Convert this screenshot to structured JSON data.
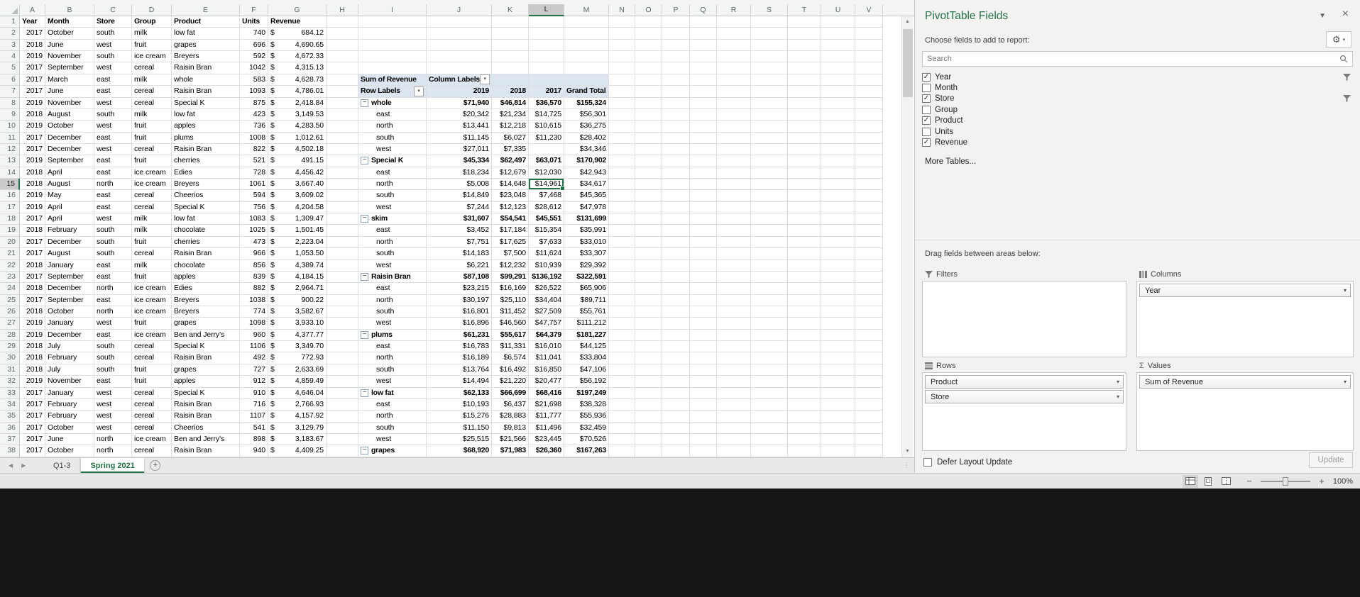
{
  "sheet": {
    "column_letters": [
      "A",
      "B",
      "C",
      "D",
      "E",
      "F",
      "G",
      "H",
      "I",
      "J",
      "K",
      "L",
      "M",
      "N",
      "O",
      "P",
      "Q",
      "R",
      "S",
      "T",
      "U",
      "V"
    ],
    "selected": {
      "col": "L",
      "row": 15
    },
    "table": {
      "headers": [
        "Year",
        "Month",
        "Store",
        "Group",
        "Product",
        "Units",
        "Revenue"
      ],
      "rows": [
        [
          2017,
          "October",
          "south",
          "milk",
          "low fat",
          740,
          684.12
        ],
        [
          2018,
          "June",
          "west",
          "fruit",
          "grapes",
          696,
          4690.65
        ],
        [
          2019,
          "November",
          "south",
          "ice cream",
          "Breyers",
          592,
          4672.33
        ],
        [
          2017,
          "September",
          "west",
          "cereal",
          "Raisin Bran",
          1042,
          4315.13
        ],
        [
          2017,
          "March",
          "east",
          "milk",
          "whole",
          583,
          4628.73
        ],
        [
          2017,
          "June",
          "east",
          "cereal",
          "Raisin Bran",
          1093,
          4786.01
        ],
        [
          2019,
          "November",
          "west",
          "cereal",
          "Special K",
          875,
          2418.84
        ],
        [
          2018,
          "August",
          "south",
          "milk",
          "low fat",
          423,
          3149.53
        ],
        [
          2019,
          "October",
          "west",
          "fruit",
          "apples",
          736,
          4283.5
        ],
        [
          2017,
          "December",
          "east",
          "fruit",
          "plums",
          1008,
          1012.61
        ],
        [
          2017,
          "December",
          "west",
          "cereal",
          "Raisin Bran",
          822,
          4502.18
        ],
        [
          2019,
          "September",
          "east",
          "fruit",
          "cherries",
          521,
          491.15
        ],
        [
          2018,
          "April",
          "east",
          "ice cream",
          "Edies",
          728,
          4456.42
        ],
        [
          2018,
          "August",
          "north",
          "ice cream",
          "Breyers",
          1061,
          3667.4
        ],
        [
          2019,
          "May",
          "east",
          "cereal",
          "Cheerios",
          594,
          3609.02
        ],
        [
          2019,
          "April",
          "east",
          "cereal",
          "Special K",
          756,
          4204.58
        ],
        [
          2017,
          "April",
          "west",
          "milk",
          "low fat",
          1083,
          1309.47
        ],
        [
          2018,
          "February",
          "south",
          "milk",
          "chocolate",
          1025,
          1501.45
        ],
        [
          2017,
          "December",
          "south",
          "fruit",
          "cherries",
          473,
          2223.04
        ],
        [
          2017,
          "August",
          "south",
          "cereal",
          "Raisin Bran",
          966,
          1053.5
        ],
        [
          2018,
          "January",
          "east",
          "milk",
          "chocolate",
          856,
          4389.74
        ],
        [
          2017,
          "September",
          "east",
          "fruit",
          "apples",
          839,
          4184.15
        ],
        [
          2018,
          "December",
          "north",
          "ice cream",
          "Edies",
          882,
          2964.71
        ],
        [
          2017,
          "September",
          "east",
          "ice cream",
          "Breyers",
          1038,
          900.22
        ],
        [
          2018,
          "October",
          "north",
          "ice cream",
          "Breyers",
          774,
          3582.67
        ],
        [
          2019,
          "January",
          "west",
          "fruit",
          "grapes",
          1098,
          3933.1
        ],
        [
          2019,
          "December",
          "east",
          "ice cream",
          "Ben and Jerry's",
          960,
          4377.77
        ],
        [
          2018,
          "July",
          "south",
          "cereal",
          "Special K",
          1106,
          3349.7
        ],
        [
          2018,
          "February",
          "south",
          "cereal",
          "Raisin Bran",
          492,
          772.93
        ],
        [
          2018,
          "July",
          "south",
          "fruit",
          "grapes",
          727,
          2633.69
        ],
        [
          2019,
          "November",
          "east",
          "fruit",
          "apples",
          912,
          4859.49
        ],
        [
          2017,
          "January",
          "west",
          "cereal",
          "Special K",
          910,
          4646.04
        ],
        [
          2017,
          "February",
          "west",
          "cereal",
          "Raisin Bran",
          716,
          2766.93
        ],
        [
          2017,
          "February",
          "west",
          "cereal",
          "Raisin Bran",
          1107,
          4157.92
        ],
        [
          2017,
          "October",
          "west",
          "cereal",
          "Cheerios",
          541,
          3129.79
        ],
        [
          2017,
          "June",
          "north",
          "ice cream",
          "Ben and Jerry's",
          898,
          3183.67
        ],
        [
          2017,
          "October",
          "north",
          "cereal",
          "Raisin Bran",
          940,
          4409.25
        ]
      ]
    },
    "pivot": {
      "title_cell": "Sum of Revenue",
      "column_labels": "Column Labels",
      "row_labels": "Row Labels",
      "col_headers": [
        "2019",
        "2018",
        "2017",
        "Grand Total"
      ],
      "rows": [
        {
          "label": "whole",
          "group": true,
          "values": [
            71940,
            46814,
            36570,
            155324
          ]
        },
        {
          "label": "east",
          "group": false,
          "values": [
            20342,
            21234,
            14725,
            56301
          ]
        },
        {
          "label": "north",
          "group": false,
          "values": [
            13441,
            12218,
            10615,
            36275
          ]
        },
        {
          "label": "south",
          "group": false,
          "values": [
            11145,
            6027,
            11230,
            28402
          ]
        },
        {
          "label": "west",
          "group": false,
          "values": [
            27011,
            7335,
            null,
            34346
          ]
        },
        {
          "label": "Special K",
          "group": true,
          "values": [
            45334,
            62497,
            63071,
            170902
          ]
        },
        {
          "label": "east",
          "group": false,
          "values": [
            18234,
            12679,
            12030,
            42943
          ]
        },
        {
          "label": "north",
          "group": false,
          "values": [
            5008,
            14648,
            14961,
            34617
          ]
        },
        {
          "label": "south",
          "group": false,
          "values": [
            14849,
            23048,
            7468,
            45365
          ]
        },
        {
          "label": "west",
          "group": false,
          "values": [
            7244,
            12123,
            28612,
            47978
          ]
        },
        {
          "label": "skim",
          "group": true,
          "values": [
            31607,
            54541,
            45551,
            131699
          ]
        },
        {
          "label": "east",
          "group": false,
          "values": [
            3452,
            17184,
            15354,
            35991
          ]
        },
        {
          "label": "north",
          "group": false,
          "values": [
            7751,
            17625,
            7633,
            33010
          ]
        },
        {
          "label": "south",
          "group": false,
          "values": [
            14183,
            7500,
            11624,
            33307
          ]
        },
        {
          "label": "west",
          "group": false,
          "values": [
            6221,
            12232,
            10939,
            29392
          ]
        },
        {
          "label": "Raisin Bran",
          "group": true,
          "values": [
            87108,
            99291,
            136192,
            322591
          ]
        },
        {
          "label": "east",
          "group": false,
          "values": [
            23215,
            16169,
            26522,
            65906
          ]
        },
        {
          "label": "north",
          "group": false,
          "values": [
            30197,
            25110,
            34404,
            89711
          ]
        },
        {
          "label": "south",
          "group": false,
          "values": [
            16801,
            11452,
            27509,
            55761
          ]
        },
        {
          "label": "west",
          "group": false,
          "values": [
            16896,
            46560,
            47757,
            111212
          ]
        },
        {
          "label": "plums",
          "group": true,
          "values": [
            61231,
            55617,
            64379,
            181227
          ]
        },
        {
          "label": "east",
          "group": false,
          "values": [
            16783,
            11331,
            16010,
            44125
          ]
        },
        {
          "label": "north",
          "group": false,
          "values": [
            16189,
            6574,
            11041,
            33804
          ]
        },
        {
          "label": "south",
          "group": false,
          "values": [
            13764,
            16492,
            16850,
            47106
          ]
        },
        {
          "label": "west",
          "group": false,
          "values": [
            14494,
            21220,
            20477,
            56192
          ]
        },
        {
          "label": "low fat",
          "group": true,
          "values": [
            62133,
            66699,
            68416,
            197249
          ]
        },
        {
          "label": "east",
          "group": false,
          "values": [
            10193,
            6437,
            21698,
            38328
          ]
        },
        {
          "label": "north",
          "group": false,
          "values": [
            15276,
            28883,
            11777,
            55936
          ]
        },
        {
          "label": "south",
          "group": false,
          "values": [
            11150,
            9813,
            11496,
            32459
          ]
        },
        {
          "label": "west",
          "group": false,
          "values": [
            25515,
            21566,
            23445,
            70526
          ]
        },
        {
          "label": "grapes",
          "group": true,
          "values": [
            68920,
            71983,
            26360,
            167263
          ]
        }
      ]
    }
  },
  "tabs": {
    "items": [
      {
        "label": "Q1-3",
        "active": false
      },
      {
        "label": "Spring 2021",
        "active": true
      }
    ]
  },
  "status_bar": {
    "zoom_label": "100%"
  },
  "fields_pane": {
    "title": "PivotTable Fields",
    "subtitle": "Choose fields to add to report:",
    "search_placeholder": "Search",
    "fields": [
      {
        "label": "Year",
        "checked": true,
        "filter": true
      },
      {
        "label": "Month",
        "checked": false,
        "filter": false
      },
      {
        "label": "Store",
        "checked": true,
        "filter": true
      },
      {
        "label": "Group",
        "checked": false,
        "filter": false
      },
      {
        "label": "Product",
        "checked": true,
        "filter": false
      },
      {
        "label": "Units",
        "checked": false,
        "filter": false
      },
      {
        "label": "Revenue",
        "checked": true,
        "filter": false
      }
    ],
    "more_tables": "More Tables...",
    "drag_label": "Drag fields between areas below:",
    "areas": {
      "filters": {
        "label": "Filters",
        "items": []
      },
      "columns": {
        "label": "Columns",
        "items": [
          "Year"
        ]
      },
      "rows": {
        "label": "Rows",
        "items": [
          "Product",
          "Store"
        ]
      },
      "values": {
        "label": "Values",
        "items": [
          "Sum of Revenue"
        ]
      }
    },
    "defer_label": "Defer Layout Update",
    "update_label": "Update"
  }
}
